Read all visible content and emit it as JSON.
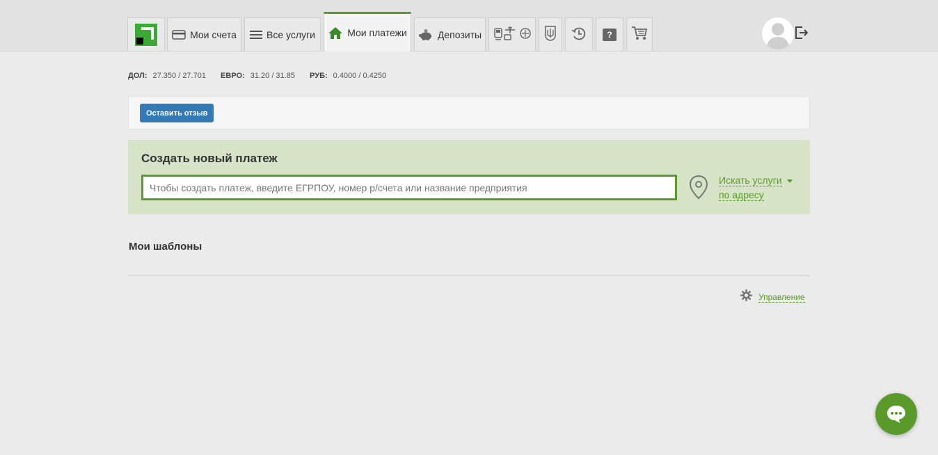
{
  "nav": {
    "tabs": [
      {
        "label": "Мои счета",
        "icon": "card-icon"
      },
      {
        "label": "Все услуги",
        "icon": "list-icon"
      },
      {
        "label": "Мои платежи",
        "icon": "home-icon",
        "active": true
      },
      {
        "label": "Депозиты",
        "icon": "piggy-bank-icon"
      }
    ],
    "icon_tabs": [
      "transport-icon",
      "coat-of-arms-icon",
      "history-icon",
      "help-icon",
      "cart-icon"
    ],
    "help_symbol": "?"
  },
  "rates": {
    "usd_label": "ДОЛ:",
    "usd_value": "27.350 / 27.701",
    "eur_label": "ЕВРО:",
    "eur_value": "31.20 / 31.85",
    "rub_label": "РУБ:",
    "rub_value": "0.4000 / 0.4250"
  },
  "feedback": {
    "button_label": "Оставить отзыв"
  },
  "payment": {
    "title": "Создать новый платеж",
    "input_value": "",
    "input_placeholder": "Чтобы создать платеж, введите ЕГРПОУ, номер р/счета или название предприятия",
    "address_link_line1": "Искать услуги",
    "address_link_line2": "по адресу"
  },
  "templates": {
    "title": "Мои шаблоны",
    "manage_label": "Управление"
  },
  "colors": {
    "accent_green": "#5a9a2a",
    "button_blue": "#337ab7",
    "panel_green": "#d6e3c7"
  }
}
